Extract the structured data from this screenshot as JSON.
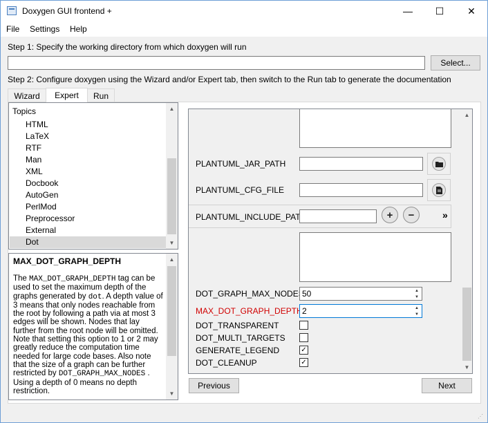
{
  "window": {
    "title": "Doxygen GUI frontend +",
    "minimize_glyph": "—",
    "maximize_glyph": "☐",
    "close_glyph": "✕"
  },
  "menu": [
    "File",
    "Settings",
    "Help"
  ],
  "step1": {
    "label": "Step 1: Specify the working directory from which doxygen will run",
    "directory_value": "",
    "select_button": "Select..."
  },
  "step2": {
    "label": "Step 2: Configure doxygen using the Wizard and/or Expert tab, then switch to the Run tab to generate the documentation"
  },
  "tabs": [
    "Wizard",
    "Expert",
    "Run"
  ],
  "active_tab": "Expert",
  "topics": {
    "header": "Topics",
    "items": [
      "HTML",
      "LaTeX",
      "RTF",
      "Man",
      "XML",
      "Docbook",
      "AutoGen",
      "PerlMod",
      "Preprocessor",
      "External",
      "Dot"
    ],
    "selected": "Dot"
  },
  "help": {
    "title": "MAX_DOT_GRAPH_DEPTH",
    "p1": "The ",
    "code1": "MAX_DOT_GRAPH_DEPTH",
    "p2": " tag can be used to set the maximum depth of the graphs generated by ",
    "code2": "dot",
    "p3": ". A depth value of 3 means that only nodes reachable from the root by following a path via at most 3 edges will be shown. Nodes that lay further from the root node will be omitted. Note that setting this option to 1 or 2 may greatly reduce the computation time needed for large code bases. Also note that the size of a graph can be further restricted by ",
    "code3": "DOT_GRAPH_MAX_NODES",
    "p4": " . Using a depth of 0 means no depth restriction."
  },
  "options": {
    "plantuml_jar_path": {
      "label": "PLANTUML_JAR_PATH",
      "value": "",
      "icon": "folder-icon"
    },
    "plantuml_cfg_file": {
      "label": "PLANTUML_CFG_FILE",
      "value": "",
      "icon": "file-icon"
    },
    "plantuml_include_path": {
      "label": "PLANTUML_INCLUDE_PATH",
      "value": "",
      "add": "+",
      "remove": "−",
      "more": "»"
    },
    "dot_graph_max_nodes": {
      "label": "DOT_GRAPH_MAX_NODES",
      "value": "50"
    },
    "max_dot_graph_depth": {
      "label": "MAX_DOT_GRAPH_DEPTH",
      "value": "2",
      "color": "#d00000"
    },
    "dot_transparent": {
      "label": "DOT_TRANSPARENT",
      "checked": false
    },
    "dot_multi_targets": {
      "label": "DOT_MULTI_TARGETS",
      "checked": false
    },
    "generate_legend": {
      "label": "GENERATE_LEGEND",
      "checked": true
    },
    "dot_cleanup": {
      "label": "DOT_CLEANUP",
      "checked": true
    }
  },
  "nav": {
    "previous": "Previous",
    "next": "Next"
  }
}
